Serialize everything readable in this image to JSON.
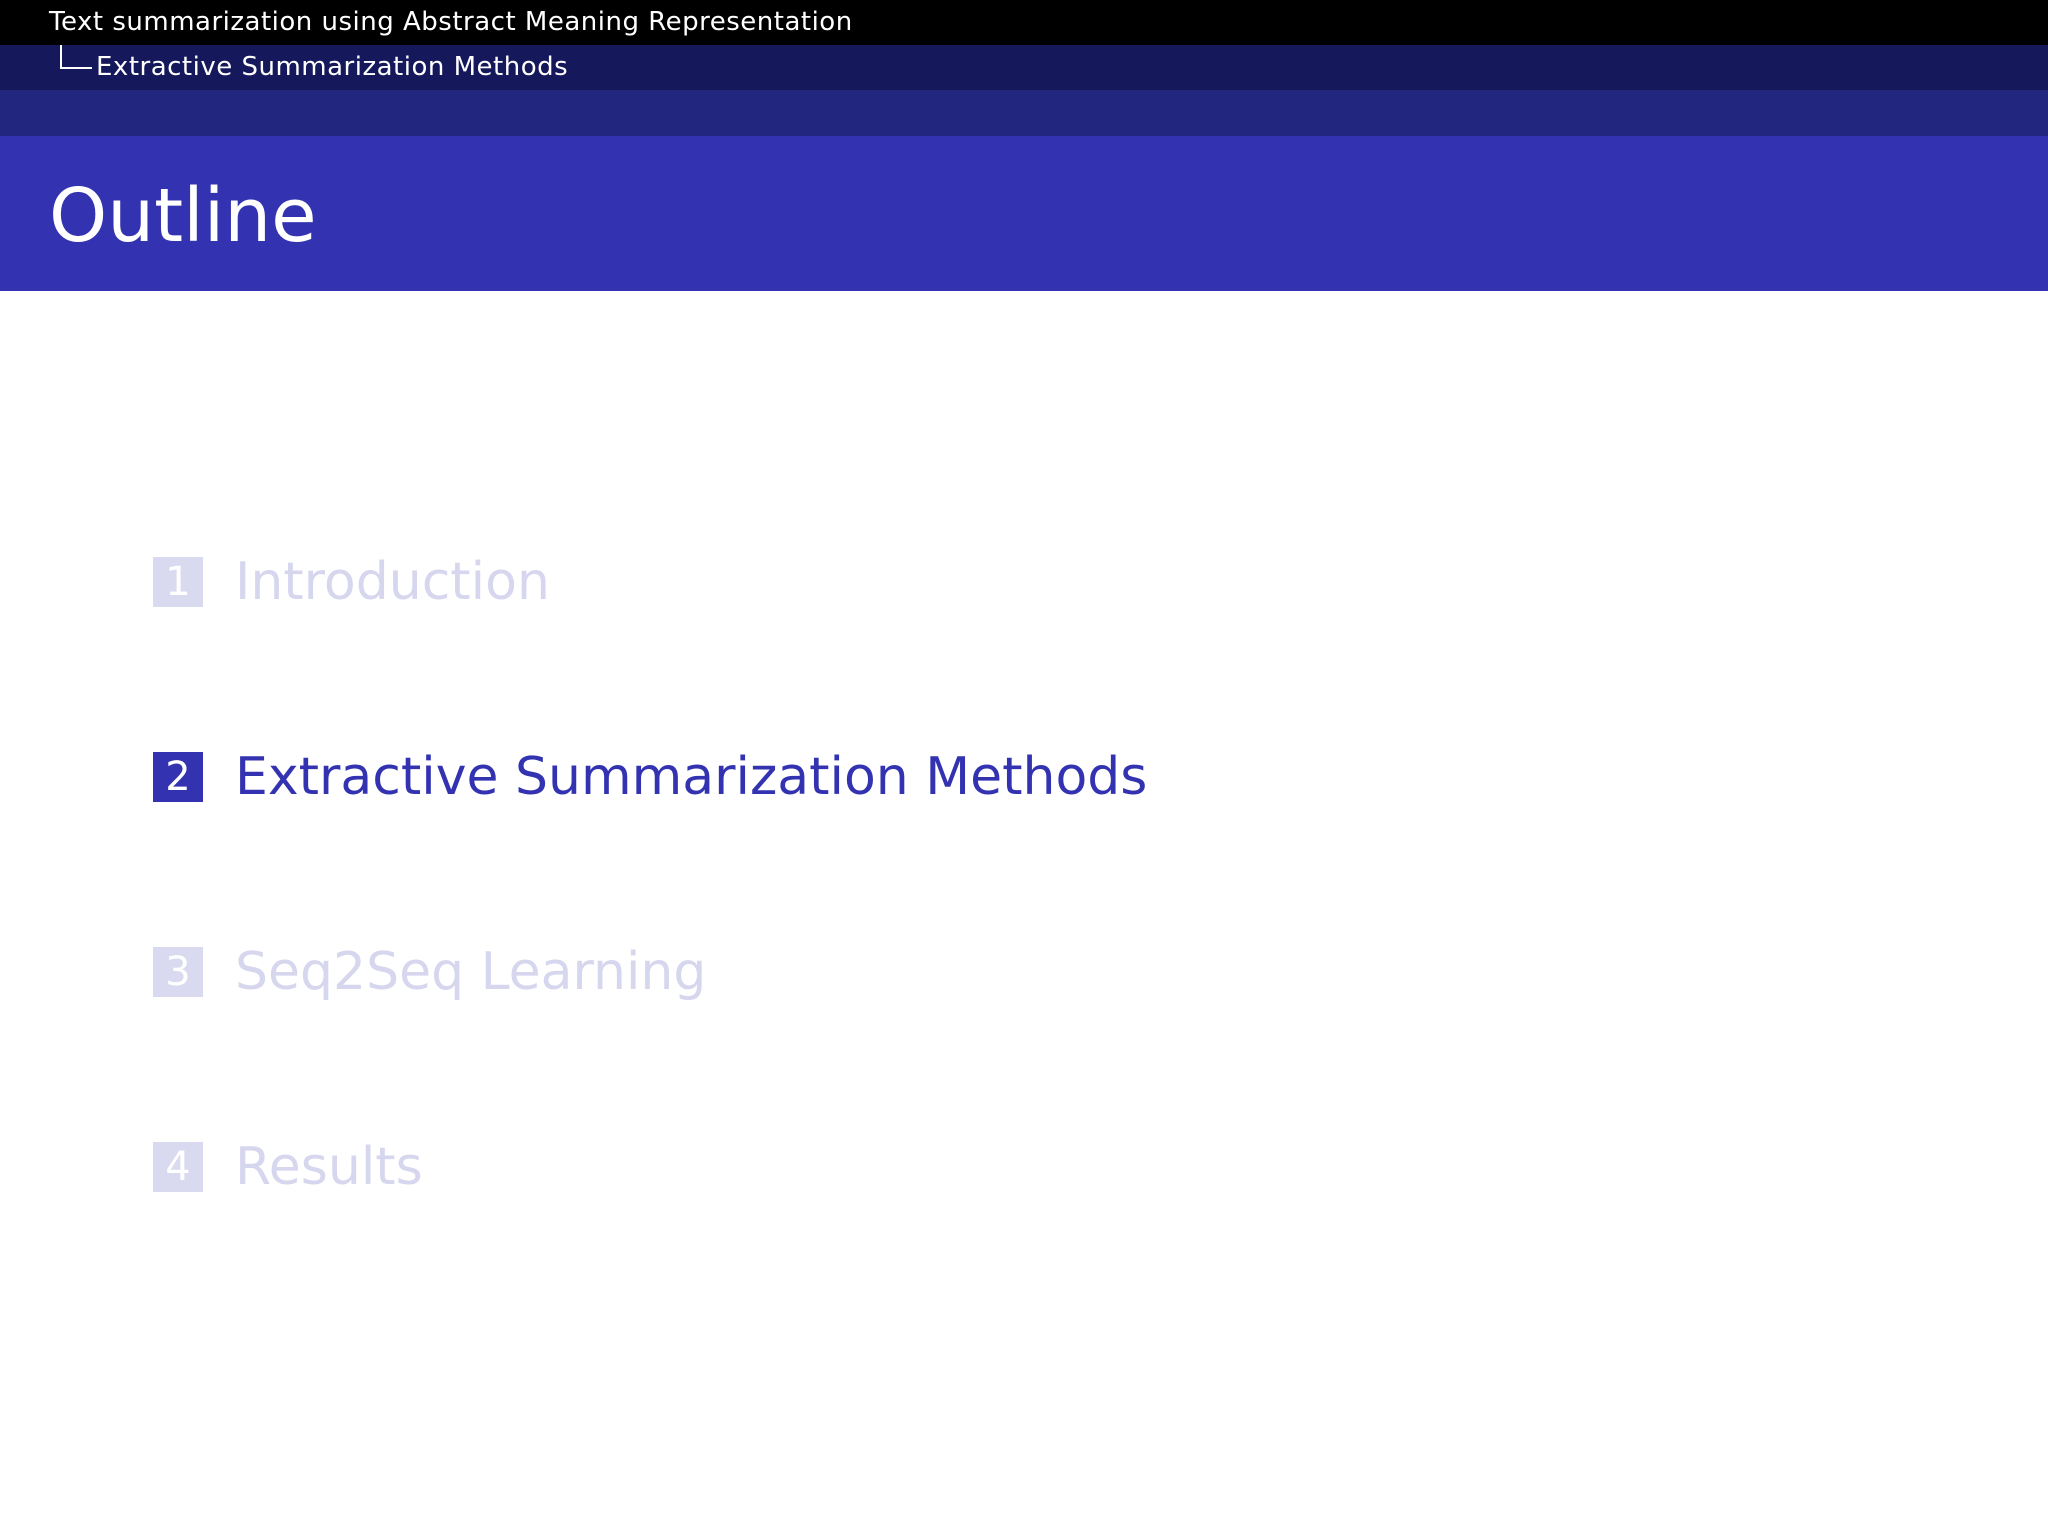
{
  "header": {
    "presentation_title": "Text summarization using Abstract Meaning Representation",
    "current_section": "Extractive Summarization Methods"
  },
  "frame": {
    "title": "Outline"
  },
  "toc": {
    "items": [
      {
        "number": "1",
        "label": "Introduction",
        "state": "shaded"
      },
      {
        "number": "2",
        "label": "Extractive Summarization Methods",
        "state": "active"
      },
      {
        "number": "3",
        "label": "Seq2Seq Learning",
        "state": "shaded"
      },
      {
        "number": "4",
        "label": "Results",
        "state": "shaded"
      }
    ]
  },
  "colors": {
    "headline_top": "#000000",
    "headline_mid": "#15185a",
    "headline_low": "#22267e",
    "accent": "#3333b2",
    "shaded_text": "#d6d6ee"
  }
}
